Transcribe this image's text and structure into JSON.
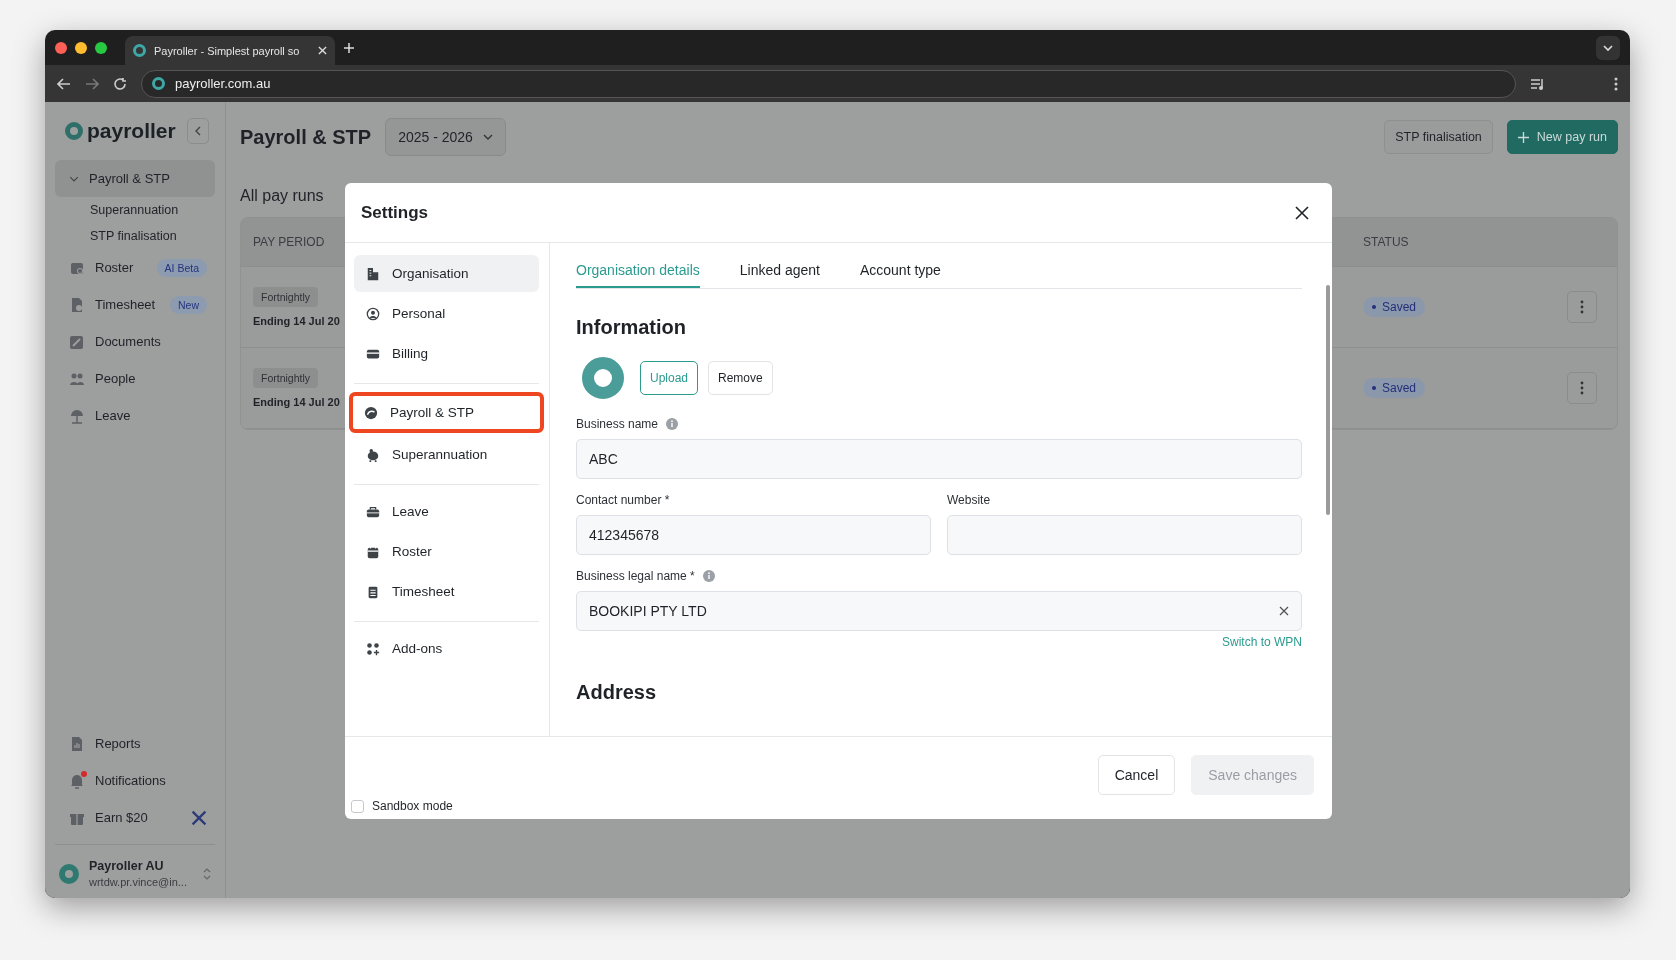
{
  "browser": {
    "tab_title": "Payroller - Simplest payroll so",
    "url": "payroller.com.au"
  },
  "sidebar": {
    "logo": "payroller",
    "items": [
      {
        "label": "Payroll & STP",
        "selected": true,
        "expanded": true,
        "children": [
          {
            "label": "Superannuation"
          },
          {
            "label": "STP finalisation"
          }
        ]
      },
      {
        "label": "Roster",
        "selected": false,
        "badge": "AI Beta"
      },
      {
        "label": "Timesheet",
        "selected": false,
        "badge": "New"
      },
      {
        "label": "Documents",
        "selected": false
      },
      {
        "label": "People",
        "selected": false
      },
      {
        "label": "Leave",
        "selected": false
      }
    ],
    "bottom_items": [
      {
        "label": "Reports",
        "alert": false
      },
      {
        "label": "Notifications",
        "alert": true
      },
      {
        "label": "Earn $20",
        "alert": false,
        "dismissable": true
      }
    ],
    "account": {
      "name": "Payroller AU",
      "email": "wrtdw.pr.vince@in..."
    }
  },
  "header": {
    "title": "Payroll & STP",
    "year": "2025 - 2026",
    "buttons": [
      {
        "label": "STP finalisation",
        "kind": "secondary"
      },
      {
        "label": "New pay run",
        "kind": "primary"
      }
    ]
  },
  "pay_runs": {
    "title": "All pay runs",
    "columns": [
      "PAY PERIOD",
      "STATUS"
    ],
    "rows": [
      {
        "frequency": "Fortnightly",
        "period": "Ending 14 Jul 20",
        "status": "Saved"
      },
      {
        "frequency": "Fortnightly",
        "period": "Ending 14 Jul 20",
        "status": "Saved"
      }
    ]
  },
  "modal": {
    "title": "Settings",
    "nav_groups": [
      [
        {
          "label": "Organisation",
          "selected": true,
          "highlighted": false
        },
        {
          "label": "Personal",
          "selected": false,
          "highlighted": false
        },
        {
          "label": "Billing",
          "selected": false,
          "highlighted": false
        }
      ],
      [
        {
          "label": "Payroll & STP",
          "selected": false,
          "highlighted": true
        },
        {
          "label": "Superannuation",
          "selected": false,
          "highlighted": false
        }
      ],
      [
        {
          "label": "Leave",
          "selected": false,
          "highlighted": false
        },
        {
          "label": "Roster",
          "selected": false,
          "highlighted": false
        },
        {
          "label": "Timesheet",
          "selected": false,
          "highlighted": false
        }
      ],
      [
        {
          "label": "Add-ons",
          "selected": false,
          "highlighted": false
        }
      ]
    ],
    "tabs": [
      {
        "label": "Organisation details",
        "selected": true
      },
      {
        "label": "Linked agent",
        "selected": false
      },
      {
        "label": "Account type",
        "selected": false
      }
    ],
    "section": "Information",
    "logo_buttons": [
      {
        "label": "Upload",
        "kind": "primary"
      },
      {
        "label": "Remove",
        "kind": "secondary"
      }
    ],
    "field_rows": [
      [
        {
          "label": "Business name",
          "info": true,
          "value": "ABC"
        }
      ],
      [
        {
          "label": "Contact number *",
          "info": false,
          "value": "412345678"
        },
        {
          "label": "Website",
          "info": false
        }
      ],
      [
        {
          "label": "Business legal name *",
          "info": true,
          "value": "BOOKIPI PTY LTD",
          "clearable": true,
          "link": "Switch to WPN"
        }
      ]
    ],
    "next_section": "Address",
    "sandbox": {
      "label": "Sandbox mode",
      "checked": false
    },
    "cancel": "Cancel",
    "save": {
      "label": "Save changes",
      "disabled": true
    }
  }
}
